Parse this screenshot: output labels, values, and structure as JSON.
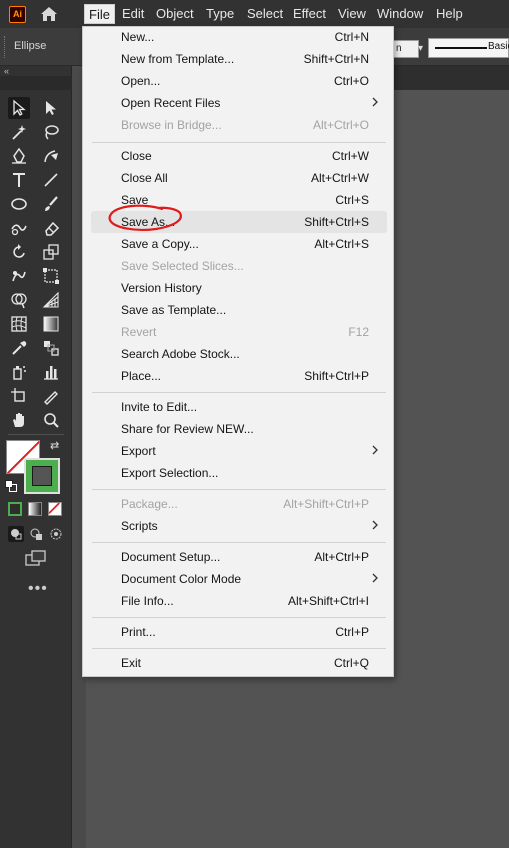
{
  "menubar": {
    "app_logo": "Ai",
    "items": [
      {
        "label": "File",
        "active": true
      },
      {
        "label": "Edit"
      },
      {
        "label": "Object"
      },
      {
        "label": "Type"
      },
      {
        "label": "Select"
      },
      {
        "label": "Effect"
      },
      {
        "label": "View"
      },
      {
        "label": "Window"
      },
      {
        "label": "Help"
      }
    ]
  },
  "control_bar": {
    "selection_label": "Ellipse",
    "dropdown_text": "n",
    "stroke_profile": "Basic"
  },
  "toolbar": {
    "collapse_icon": "«",
    "more_icon": "•••"
  },
  "file_menu": {
    "items": [
      {
        "label": "New...",
        "shortcut": "Ctrl+N"
      },
      {
        "label": "New from Template...",
        "shortcut": "Shift+Ctrl+N"
      },
      {
        "label": "Open...",
        "shortcut": "Ctrl+O"
      },
      {
        "label": "Open Recent Files",
        "shortcut": "",
        "submenu": true
      },
      {
        "label": "Browse in Bridge...",
        "shortcut": "Alt+Ctrl+O",
        "disabled": true
      },
      {
        "label": "Close",
        "shortcut": "Ctrl+W"
      },
      {
        "label": "Close All",
        "shortcut": "Alt+Ctrl+W"
      },
      {
        "label": "Save",
        "shortcut": "Ctrl+S"
      },
      {
        "label": "Save As...",
        "shortcut": "Shift+Ctrl+S",
        "highlighted": true
      },
      {
        "label": "Save a Copy...",
        "shortcut": "Alt+Ctrl+S"
      },
      {
        "label": "Save Selected Slices...",
        "shortcut": "",
        "disabled": true
      },
      {
        "label": "Version History",
        "shortcut": ""
      },
      {
        "label": "Save as Template...",
        "shortcut": ""
      },
      {
        "label": "Revert",
        "shortcut": "F12",
        "disabled": true
      },
      {
        "label": "Search Adobe Stock...",
        "shortcut": ""
      },
      {
        "label": "Place...",
        "shortcut": "Shift+Ctrl+P"
      },
      {
        "label": "Invite to Edit...",
        "shortcut": ""
      },
      {
        "label": "Share for Review NEW...",
        "shortcut": ""
      },
      {
        "label": "Export",
        "shortcut": "",
        "submenu": true
      },
      {
        "label": "Export Selection...",
        "shortcut": ""
      },
      {
        "label": "Package...",
        "shortcut": "Alt+Shift+Ctrl+P",
        "disabled": true
      },
      {
        "label": "Scripts",
        "shortcut": "",
        "submenu": true
      },
      {
        "label": "Document Setup...",
        "shortcut": "Alt+Ctrl+P"
      },
      {
        "label": "Document Color Mode",
        "shortcut": "",
        "submenu": true
      },
      {
        "label": "File Info...",
        "shortcut": "Alt+Shift+Ctrl+I"
      },
      {
        "label": "Print...",
        "shortcut": "Ctrl+P"
      },
      {
        "label": "Exit",
        "shortcut": "Ctrl+Q"
      }
    ]
  },
  "colors": {
    "menubar_bg": "#323232",
    "menu_bg": "#f2f2f2",
    "disabled_text": "#a3a3a3",
    "annotation_red": "#e01b1b",
    "stroke_swatch": "#4cae4c"
  },
  "annotation": {
    "shape": "red hand-drawn ellipse",
    "target": "Save As..."
  }
}
